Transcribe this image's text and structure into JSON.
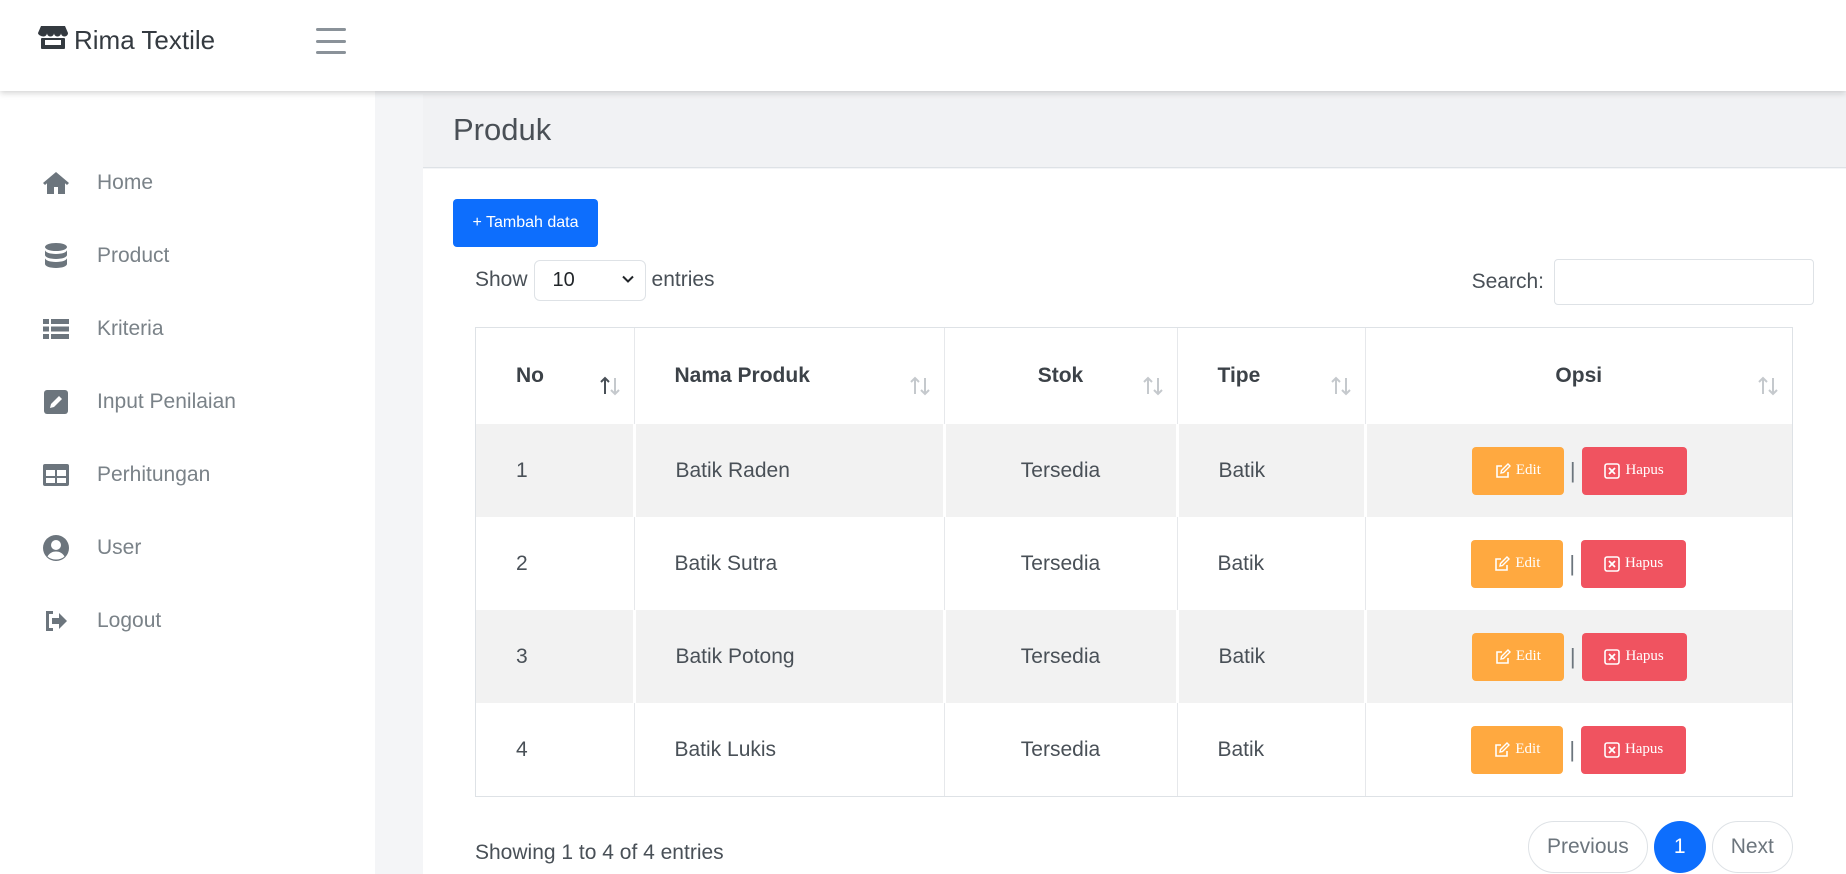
{
  "brand": {
    "name": "Rima Textile",
    "icon": "store-icon"
  },
  "sidebar": {
    "items": [
      {
        "label": "Home",
        "icon": "home-icon"
      },
      {
        "label": "Product",
        "icon": "database-icon"
      },
      {
        "label": "Kriteria",
        "icon": "list-icon"
      },
      {
        "label": "Input Penilaian",
        "icon": "edit-icon"
      },
      {
        "label": "Perhitungan",
        "icon": "table-icon"
      },
      {
        "label": "User",
        "icon": "user-circle-icon"
      },
      {
        "label": "Logout",
        "icon": "logout-icon"
      }
    ]
  },
  "page": {
    "title": "Produk"
  },
  "toolbar": {
    "add_label": "+ Tambah data"
  },
  "length": {
    "show_label": "Show",
    "value": "10",
    "entries_label": "entries"
  },
  "search": {
    "label": "Search:",
    "value": ""
  },
  "table": {
    "headers": [
      "No",
      "Nama Produk",
      "Stok",
      "Tipe",
      "Opsi"
    ],
    "rows": [
      {
        "no": "1",
        "nama": "Batik Raden",
        "stok": "Tersedia",
        "tipe": "Batik"
      },
      {
        "no": "2",
        "nama": "Batik Sutra",
        "stok": "Tersedia",
        "tipe": "Batik"
      },
      {
        "no": "3",
        "nama": "Batik Potong",
        "stok": "Tersedia",
        "tipe": "Batik"
      },
      {
        "no": "4",
        "nama": "Batik Lukis",
        "stok": "Tersedia",
        "tipe": "Batik"
      }
    ],
    "edit_label": "Edit",
    "hapus_label": "Hapus",
    "separator": "|"
  },
  "footer": {
    "info": "Showing 1 to 4 of 4 entries",
    "previous": "Previous",
    "current_page": "1",
    "next": "Next"
  },
  "colors": {
    "primary": "#0d6efd",
    "edit": "#ffa940",
    "hapus": "#f05360"
  }
}
